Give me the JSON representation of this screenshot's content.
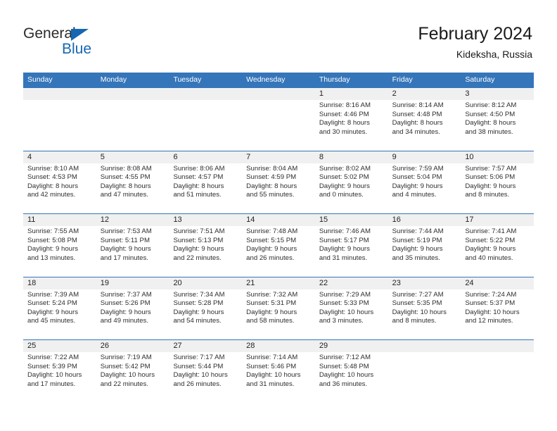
{
  "brand": {
    "name_part1": "General",
    "name_part2": "Blue",
    "triangle_icon": "triangle-icon",
    "accent_color": "#1567b2"
  },
  "header": {
    "title": "February 2024",
    "subtitle": "Kideksha, Russia"
  },
  "colors": {
    "header_bar": "#3575b9",
    "day_number_band": "#f0f0f0",
    "text": "#2e2e2e"
  },
  "weekdays": [
    "Sunday",
    "Monday",
    "Tuesday",
    "Wednesday",
    "Thursday",
    "Friday",
    "Saturday"
  ],
  "weeks": [
    [
      {
        "day": "",
        "sunrise": "",
        "sunset": "",
        "daylight_line1": "",
        "daylight_line2": ""
      },
      {
        "day": "",
        "sunrise": "",
        "sunset": "",
        "daylight_line1": "",
        "daylight_line2": ""
      },
      {
        "day": "",
        "sunrise": "",
        "sunset": "",
        "daylight_line1": "",
        "daylight_line2": ""
      },
      {
        "day": "",
        "sunrise": "",
        "sunset": "",
        "daylight_line1": "",
        "daylight_line2": ""
      },
      {
        "day": "1",
        "sunrise": "Sunrise: 8:16 AM",
        "sunset": "Sunset: 4:46 PM",
        "daylight_line1": "Daylight: 8 hours",
        "daylight_line2": "and 30 minutes."
      },
      {
        "day": "2",
        "sunrise": "Sunrise: 8:14 AM",
        "sunset": "Sunset: 4:48 PM",
        "daylight_line1": "Daylight: 8 hours",
        "daylight_line2": "and 34 minutes."
      },
      {
        "day": "3",
        "sunrise": "Sunrise: 8:12 AM",
        "sunset": "Sunset: 4:50 PM",
        "daylight_line1": "Daylight: 8 hours",
        "daylight_line2": "and 38 minutes."
      }
    ],
    [
      {
        "day": "4",
        "sunrise": "Sunrise: 8:10 AM",
        "sunset": "Sunset: 4:53 PM",
        "daylight_line1": "Daylight: 8 hours",
        "daylight_line2": "and 42 minutes."
      },
      {
        "day": "5",
        "sunrise": "Sunrise: 8:08 AM",
        "sunset": "Sunset: 4:55 PM",
        "daylight_line1": "Daylight: 8 hours",
        "daylight_line2": "and 47 minutes."
      },
      {
        "day": "6",
        "sunrise": "Sunrise: 8:06 AM",
        "sunset": "Sunset: 4:57 PM",
        "daylight_line1": "Daylight: 8 hours",
        "daylight_line2": "and 51 minutes."
      },
      {
        "day": "7",
        "sunrise": "Sunrise: 8:04 AM",
        "sunset": "Sunset: 4:59 PM",
        "daylight_line1": "Daylight: 8 hours",
        "daylight_line2": "and 55 minutes."
      },
      {
        "day": "8",
        "sunrise": "Sunrise: 8:02 AM",
        "sunset": "Sunset: 5:02 PM",
        "daylight_line1": "Daylight: 9 hours",
        "daylight_line2": "and 0 minutes."
      },
      {
        "day": "9",
        "sunrise": "Sunrise: 7:59 AM",
        "sunset": "Sunset: 5:04 PM",
        "daylight_line1": "Daylight: 9 hours",
        "daylight_line2": "and 4 minutes."
      },
      {
        "day": "10",
        "sunrise": "Sunrise: 7:57 AM",
        "sunset": "Sunset: 5:06 PM",
        "daylight_line1": "Daylight: 9 hours",
        "daylight_line2": "and 8 minutes."
      }
    ],
    [
      {
        "day": "11",
        "sunrise": "Sunrise: 7:55 AM",
        "sunset": "Sunset: 5:08 PM",
        "daylight_line1": "Daylight: 9 hours",
        "daylight_line2": "and 13 minutes."
      },
      {
        "day": "12",
        "sunrise": "Sunrise: 7:53 AM",
        "sunset": "Sunset: 5:11 PM",
        "daylight_line1": "Daylight: 9 hours",
        "daylight_line2": "and 17 minutes."
      },
      {
        "day": "13",
        "sunrise": "Sunrise: 7:51 AM",
        "sunset": "Sunset: 5:13 PM",
        "daylight_line1": "Daylight: 9 hours",
        "daylight_line2": "and 22 minutes."
      },
      {
        "day": "14",
        "sunrise": "Sunrise: 7:48 AM",
        "sunset": "Sunset: 5:15 PM",
        "daylight_line1": "Daylight: 9 hours",
        "daylight_line2": "and 26 minutes."
      },
      {
        "day": "15",
        "sunrise": "Sunrise: 7:46 AM",
        "sunset": "Sunset: 5:17 PM",
        "daylight_line1": "Daylight: 9 hours",
        "daylight_line2": "and 31 minutes."
      },
      {
        "day": "16",
        "sunrise": "Sunrise: 7:44 AM",
        "sunset": "Sunset: 5:19 PM",
        "daylight_line1": "Daylight: 9 hours",
        "daylight_line2": "and 35 minutes."
      },
      {
        "day": "17",
        "sunrise": "Sunrise: 7:41 AM",
        "sunset": "Sunset: 5:22 PM",
        "daylight_line1": "Daylight: 9 hours",
        "daylight_line2": "and 40 minutes."
      }
    ],
    [
      {
        "day": "18",
        "sunrise": "Sunrise: 7:39 AM",
        "sunset": "Sunset: 5:24 PM",
        "daylight_line1": "Daylight: 9 hours",
        "daylight_line2": "and 45 minutes."
      },
      {
        "day": "19",
        "sunrise": "Sunrise: 7:37 AM",
        "sunset": "Sunset: 5:26 PM",
        "daylight_line1": "Daylight: 9 hours",
        "daylight_line2": "and 49 minutes."
      },
      {
        "day": "20",
        "sunrise": "Sunrise: 7:34 AM",
        "sunset": "Sunset: 5:28 PM",
        "daylight_line1": "Daylight: 9 hours",
        "daylight_line2": "and 54 minutes."
      },
      {
        "day": "21",
        "sunrise": "Sunrise: 7:32 AM",
        "sunset": "Sunset: 5:31 PM",
        "daylight_line1": "Daylight: 9 hours",
        "daylight_line2": "and 58 minutes."
      },
      {
        "day": "22",
        "sunrise": "Sunrise: 7:29 AM",
        "sunset": "Sunset: 5:33 PM",
        "daylight_line1": "Daylight: 10 hours",
        "daylight_line2": "and 3 minutes."
      },
      {
        "day": "23",
        "sunrise": "Sunrise: 7:27 AM",
        "sunset": "Sunset: 5:35 PM",
        "daylight_line1": "Daylight: 10 hours",
        "daylight_line2": "and 8 minutes."
      },
      {
        "day": "24",
        "sunrise": "Sunrise: 7:24 AM",
        "sunset": "Sunset: 5:37 PM",
        "daylight_line1": "Daylight: 10 hours",
        "daylight_line2": "and 12 minutes."
      }
    ],
    [
      {
        "day": "25",
        "sunrise": "Sunrise: 7:22 AM",
        "sunset": "Sunset: 5:39 PM",
        "daylight_line1": "Daylight: 10 hours",
        "daylight_line2": "and 17 minutes."
      },
      {
        "day": "26",
        "sunrise": "Sunrise: 7:19 AM",
        "sunset": "Sunset: 5:42 PM",
        "daylight_line1": "Daylight: 10 hours",
        "daylight_line2": "and 22 minutes."
      },
      {
        "day": "27",
        "sunrise": "Sunrise: 7:17 AM",
        "sunset": "Sunset: 5:44 PM",
        "daylight_line1": "Daylight: 10 hours",
        "daylight_line2": "and 26 minutes."
      },
      {
        "day": "28",
        "sunrise": "Sunrise: 7:14 AM",
        "sunset": "Sunset: 5:46 PM",
        "daylight_line1": "Daylight: 10 hours",
        "daylight_line2": "and 31 minutes."
      },
      {
        "day": "29",
        "sunrise": "Sunrise: 7:12 AM",
        "sunset": "Sunset: 5:48 PM",
        "daylight_line1": "Daylight: 10 hours",
        "daylight_line2": "and 36 minutes."
      },
      {
        "day": "",
        "sunrise": "",
        "sunset": "",
        "daylight_line1": "",
        "daylight_line2": ""
      },
      {
        "day": "",
        "sunrise": "",
        "sunset": "",
        "daylight_line1": "",
        "daylight_line2": ""
      }
    ]
  ]
}
